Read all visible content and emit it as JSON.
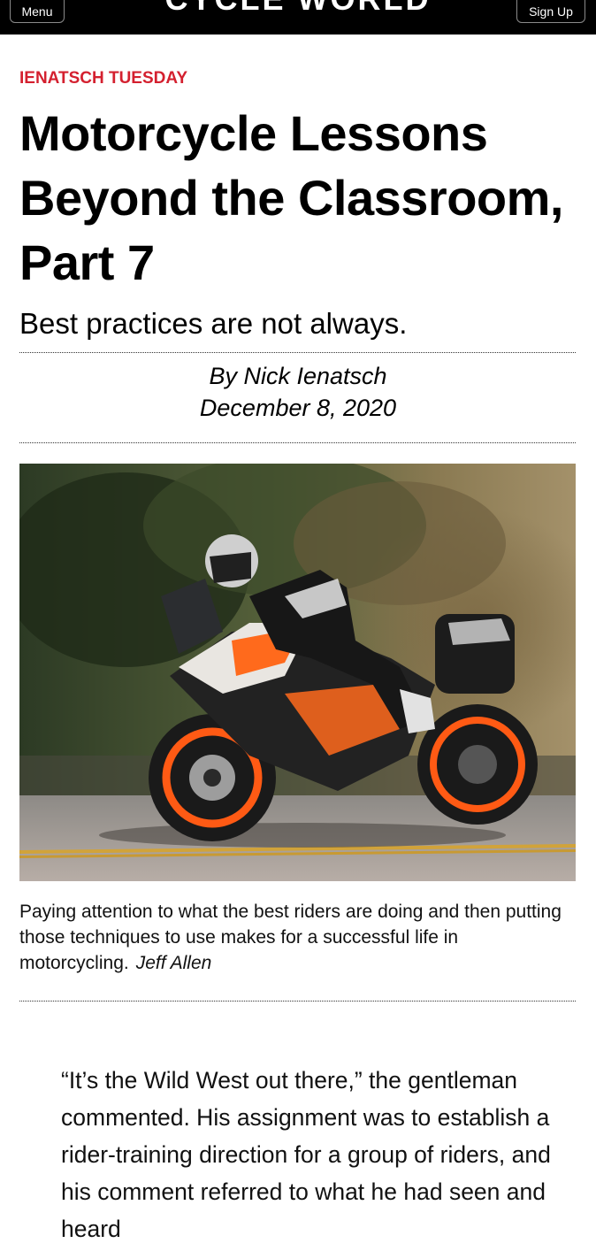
{
  "header": {
    "menu_label": "Menu",
    "logo_text": "CYCLE WORLD",
    "signup_label": "Sign Up"
  },
  "article": {
    "kicker": "IENATSCH TUESDAY",
    "title": "Motorcycle Lessons Beyond the Classroom, Part 7",
    "subtitle": "Best practices are not always.",
    "byline": "By Nick Ienatsch",
    "date": "December 8, 2020",
    "image_caption": "Paying attention to what the best riders are doing and then putting those techniques to use makes for a successful life in motorcycling.",
    "image_credit": "Jeff Allen",
    "body_text": "“It’s the Wild West out there,” the gentleman commented. His assignment was to establish a rider-training direction for a group of riders, and his comment referred to what he had seen and heard"
  },
  "colors": {
    "kicker": "#d4202f",
    "header_bg": "#000000"
  }
}
